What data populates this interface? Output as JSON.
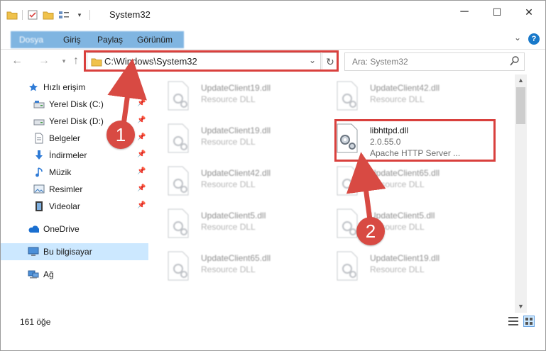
{
  "window": {
    "title": "System32",
    "controls": {
      "minimize": "─",
      "maximize": "☐",
      "close": "✕"
    }
  },
  "ribbon": {
    "tabs": [
      "Dosya",
      "Giriş",
      "Paylaş",
      "Görünüm"
    ],
    "help_label": "?"
  },
  "address_bar": {
    "path": "C:\\Windows\\System32",
    "search_placeholder": "Ara: System32"
  },
  "nav_pane": {
    "quick_access_label": "Hızlı erişim",
    "quick_items": [
      {
        "label": "Yerel Disk (C:)",
        "icon": "drive-icon"
      },
      {
        "label": "Yerel Disk (D:)",
        "icon": "drive-icon"
      },
      {
        "label": "Belgeler",
        "icon": "documents-icon"
      },
      {
        "label": "İndirmeler",
        "icon": "downloads-icon"
      },
      {
        "label": "Müzik",
        "icon": "music-icon"
      },
      {
        "label": "Resimler",
        "icon": "pictures-icon"
      },
      {
        "label": "Videolar",
        "icon": "videos-icon"
      }
    ],
    "onedrive_label": "OneDrive",
    "this_pc_label": "Bu bilgisayar",
    "network_label": "Ağ"
  },
  "files": [
    {
      "name": "UpdateClient19.dll",
      "desc": "Resource DLL"
    },
    {
      "name": "UpdateClient42.dll",
      "desc": "Resource DLL"
    },
    {
      "name": "UpdateClient19.dll",
      "desc": "Resource DLL"
    },
    {
      "name": "libhttpd.dll",
      "version": "2.0.55.0",
      "desc": "Apache HTTP Server ..."
    },
    {
      "name": "UpdateClient42.dll",
      "desc": "Resource DLL"
    },
    {
      "name": "UpdateClient65.dll",
      "desc": "Resource DLL"
    },
    {
      "name": "UpdateClient5.dll",
      "desc": "Resource DLL"
    },
    {
      "name": "UpdateClient5.dll",
      "desc": "Resource DLL"
    },
    {
      "name": "UpdateClient65.dll",
      "desc": "Resource DLL"
    },
    {
      "name": "UpdateClient19.dll",
      "desc": "Resource DLL"
    }
  ],
  "status_bar": {
    "item_count": "161 öğe"
  },
  "callouts": {
    "step1": "1",
    "step2": "2"
  },
  "colors": {
    "accent": "#1979ca",
    "highlight_red": "#d9403d",
    "badge_red": "#d84a43",
    "selection": "#cce8ff"
  }
}
